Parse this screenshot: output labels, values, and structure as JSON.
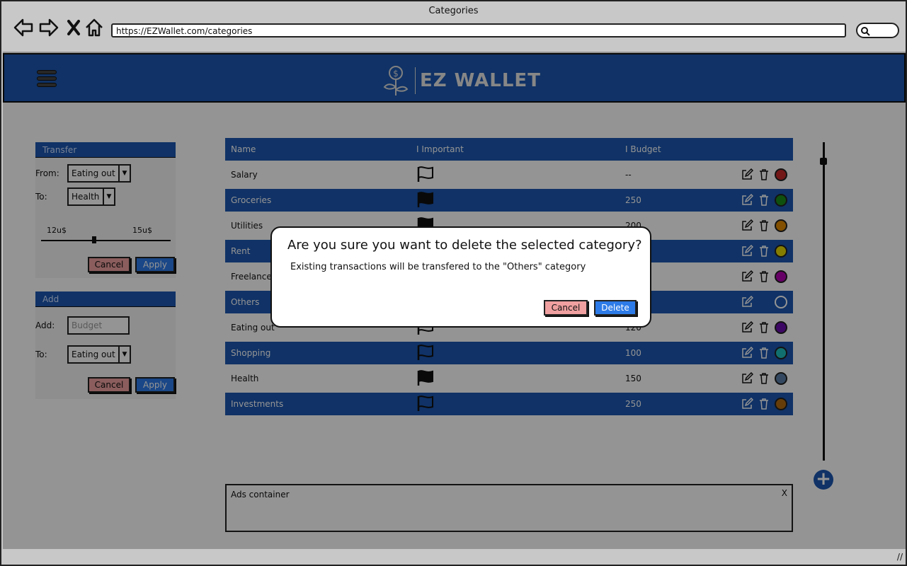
{
  "browser": {
    "title": "Categories",
    "url": "https://EZWallet.com/categories"
  },
  "app": {
    "brand": "EZ WALLET",
    "colors": {
      "primary": "#1c56b0",
      "delete": "#2d7be8",
      "cancel": "#f0a0a0"
    }
  },
  "transfer": {
    "title": "Transfer",
    "from_label": "From:",
    "from_value": "Eating out",
    "to_label": "To:",
    "to_value": "Health",
    "slider_min": "12u$",
    "slider_max": "15u$",
    "cancel": "Cancel",
    "apply": "Apply"
  },
  "add": {
    "title": "Add",
    "add_label": "Add:",
    "budget_placeholder": "Budget",
    "to_label": "To:",
    "to_value": "Eating out",
    "cancel": "Cancel",
    "apply": "Apply"
  },
  "table": {
    "headers": [
      "Name",
      "Important",
      "Budget"
    ],
    "rows": [
      {
        "name": "Salary",
        "important": false,
        "budget": "--",
        "color": "#c62828"
      },
      {
        "name": "Groceries",
        "important": true,
        "budget": "250",
        "color": "#1b8a1b"
      },
      {
        "name": "Utilities",
        "important": true,
        "budget": "200",
        "color": "#e08a00"
      },
      {
        "name": "Rent",
        "important": false,
        "budget": "",
        "color": "#e6d800"
      },
      {
        "name": "Freelance",
        "important": false,
        "budget": "",
        "color": "#b000b0"
      },
      {
        "name": "Others",
        "important": false,
        "budget": "",
        "color": "#ffffff"
      },
      {
        "name": "Eating out",
        "important": false,
        "budget": "120",
        "color": "#6a0dad"
      },
      {
        "name": "Shopping",
        "important": false,
        "budget": "100",
        "color": "#20c0c0"
      },
      {
        "name": "Health",
        "important": true,
        "budget": "150",
        "color": "#5b7fa8"
      },
      {
        "name": "Investments",
        "important": false,
        "budget": "250",
        "color": "#b06a10"
      }
    ]
  },
  "ads": {
    "label": "Ads container",
    "close": "X"
  },
  "modal": {
    "title": "Are you sure you want to delete the selected category?",
    "message": "Existing transactions will be transfered to the \"Others\" category",
    "cancel": "Cancel",
    "delete": "Delete"
  }
}
